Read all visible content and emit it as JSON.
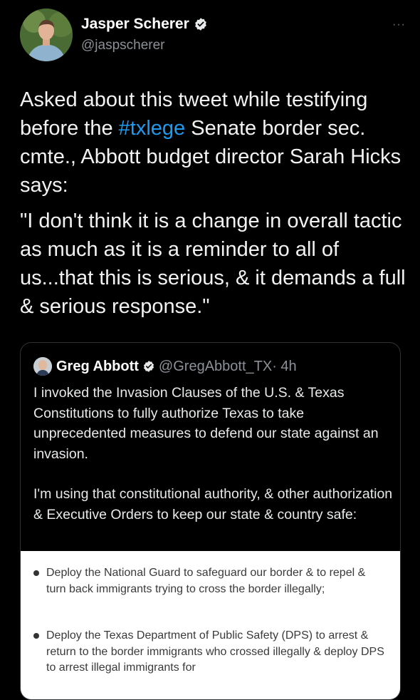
{
  "author": {
    "name": "Jasper Scherer",
    "handle": "@jaspscherer",
    "verified": true
  },
  "more_label": "···",
  "tweet": {
    "para1_before": "Asked about this tweet while testifying before the ",
    "hashtag": "#txlege",
    "para1_after": " Senate border sec. cmte., Abbott budget director Sarah Hicks says:",
    "para2": "\"I don't think it is a change in overall tactic as much as it is a reminder to all of us...that this is serious, & it demands a full & serious response.\""
  },
  "quoted": {
    "name": "Greg Abbott",
    "handle": "@GregAbbott_TX",
    "time": "· 4h",
    "para1": "I invoked the Invasion Clauses of the U.S. & Texas Constitutions to fully authorize Texas to take unprecedented measures to defend our state against an invasion.",
    "para2": "I'm using that constitutional authority, & other authorization & Executive Orders to keep our state & country safe:"
  },
  "document": {
    "items": [
      "Deploy the National Guard to safeguard our border & to repel & turn back immigrants trying to cross the border illegally;",
      "Deploy the Texas Department of Public Safety (DPS) to arrest & return to the border immigrants who crossed illegally & deploy DPS to arrest illegal immigrants for"
    ]
  },
  "colors": {
    "background": "#000000",
    "hashtag": "#1d9bf0",
    "verified": "#e7e9ea"
  }
}
